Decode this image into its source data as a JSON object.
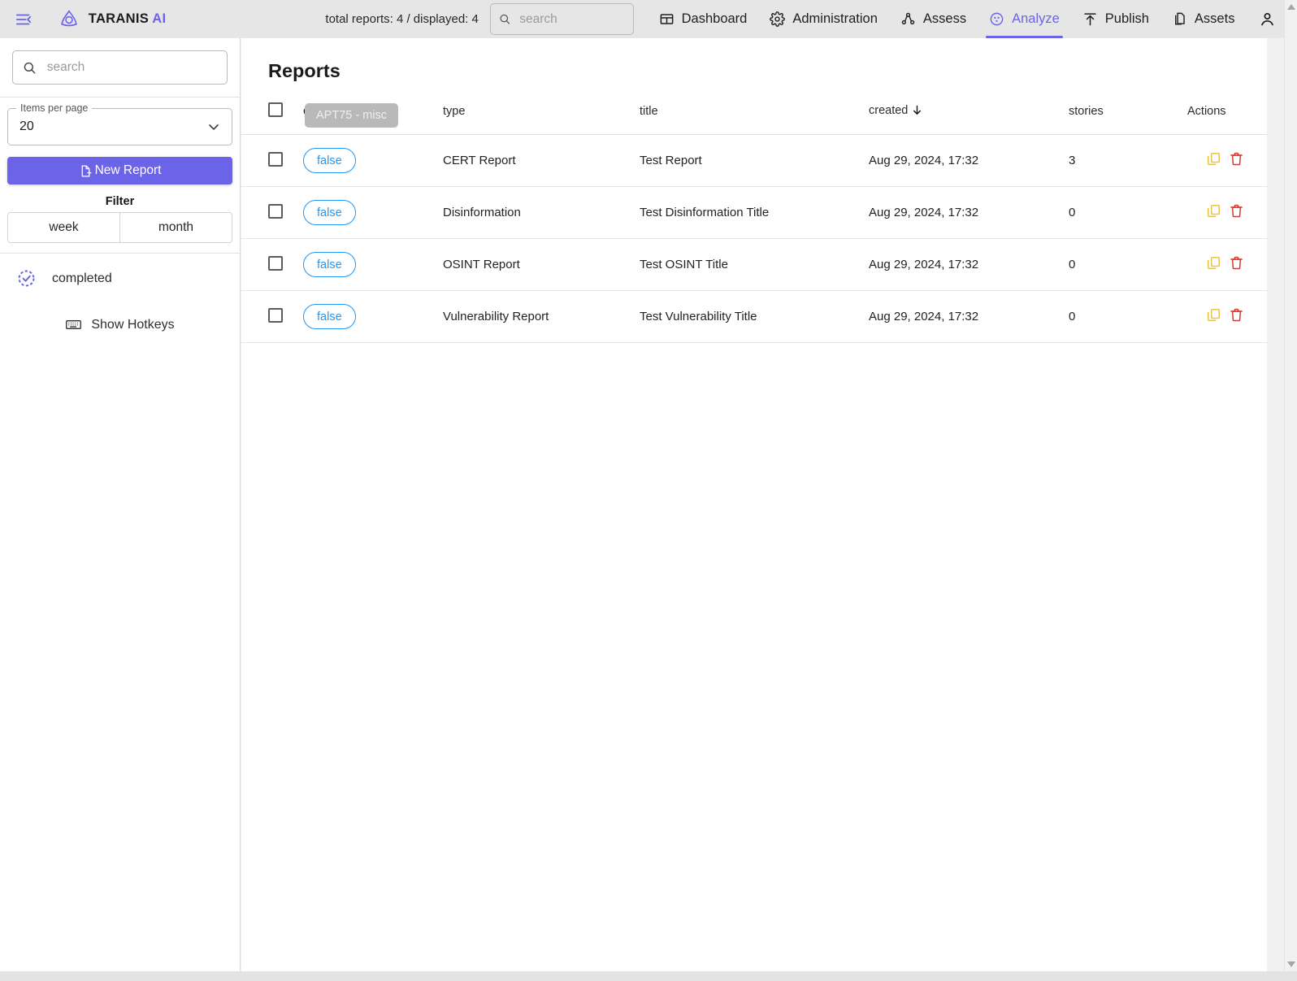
{
  "topbar": {
    "menu_icon": "hamburger-collapse-icon",
    "brand_name": "TARANIS",
    "brand_suffix": "AI",
    "report_count": "total reports: 4 / displayed: 4",
    "search_placeholder": "search",
    "search_value": "",
    "nav": [
      {
        "label": "Dashboard",
        "icon": "dashboard-grid-icon",
        "active": false
      },
      {
        "label": "Administration",
        "icon": "gear-icon",
        "active": false
      },
      {
        "label": "Assess",
        "icon": "nodes-icon",
        "active": false
      },
      {
        "label": "Analyze",
        "icon": "circle-dots-icon",
        "active": true
      },
      {
        "label": "Publish",
        "icon": "upload-arrow-icon",
        "active": false
      },
      {
        "label": "Assets",
        "icon": "documents-icon",
        "active": false
      }
    ],
    "account_icon": "person-icon"
  },
  "sidebar": {
    "search_placeholder": "search",
    "search_value": "",
    "items_per_page_legend": "Items per page",
    "items_per_page_value": "20",
    "new_report_label": "New Report",
    "new_report_icon": "document-plus-icon",
    "filter_title": "Filter",
    "toggles": [
      {
        "label": "week"
      },
      {
        "label": "month"
      }
    ],
    "status": {
      "label": "completed",
      "icon": "dashed-check-circle-icon"
    },
    "hotkeys": {
      "label": "Show Hotkeys",
      "icon": "keyboard-icon"
    }
  },
  "main": {
    "page_title": "Reports",
    "tooltip": "APT75 - misc",
    "table": {
      "columns": [
        {
          "key": "select",
          "label": ""
        },
        {
          "key": "completed",
          "label": "completed"
        },
        {
          "key": "type",
          "label": "type"
        },
        {
          "key": "title",
          "label": "title"
        },
        {
          "key": "created",
          "label": "created"
        },
        {
          "key": "stories",
          "label": "stories"
        },
        {
          "key": "actions",
          "label": "Actions"
        }
      ],
      "sort_column": "created",
      "sort_direction": "desc",
      "rows": [
        {
          "completed": "false",
          "type": "CERT Report",
          "title": "Test Report",
          "created": "Aug 29, 2024, 17:32",
          "stories": "3"
        },
        {
          "completed": "false",
          "type": "Disinformation",
          "title": "Test Disinformation Title",
          "created": "Aug 29, 2024, 17:32",
          "stories": "0"
        },
        {
          "completed": "false",
          "type": "OSINT Report",
          "title": "Test OSINT Title",
          "created": "Aug 29, 2024, 17:32",
          "stories": "0"
        },
        {
          "completed": "false",
          "type": "Vulnerability Report",
          "title": "Test Vulnerability Title",
          "created": "Aug 29, 2024, 17:32",
          "stories": "0"
        }
      ],
      "row_actions": [
        {
          "name": "clone-icon",
          "color": "#e8c34a"
        },
        {
          "name": "delete-icon",
          "color": "#d63a2f"
        }
      ]
    }
  },
  "colors": {
    "accent": "#6b63e8",
    "chip_blue": "#2196f3",
    "clone_yellow": "#e8c34a",
    "delete_red": "#d63a2f",
    "topbar_bg": "#e6e6e6",
    "page_bg": "#f1f1f1"
  }
}
